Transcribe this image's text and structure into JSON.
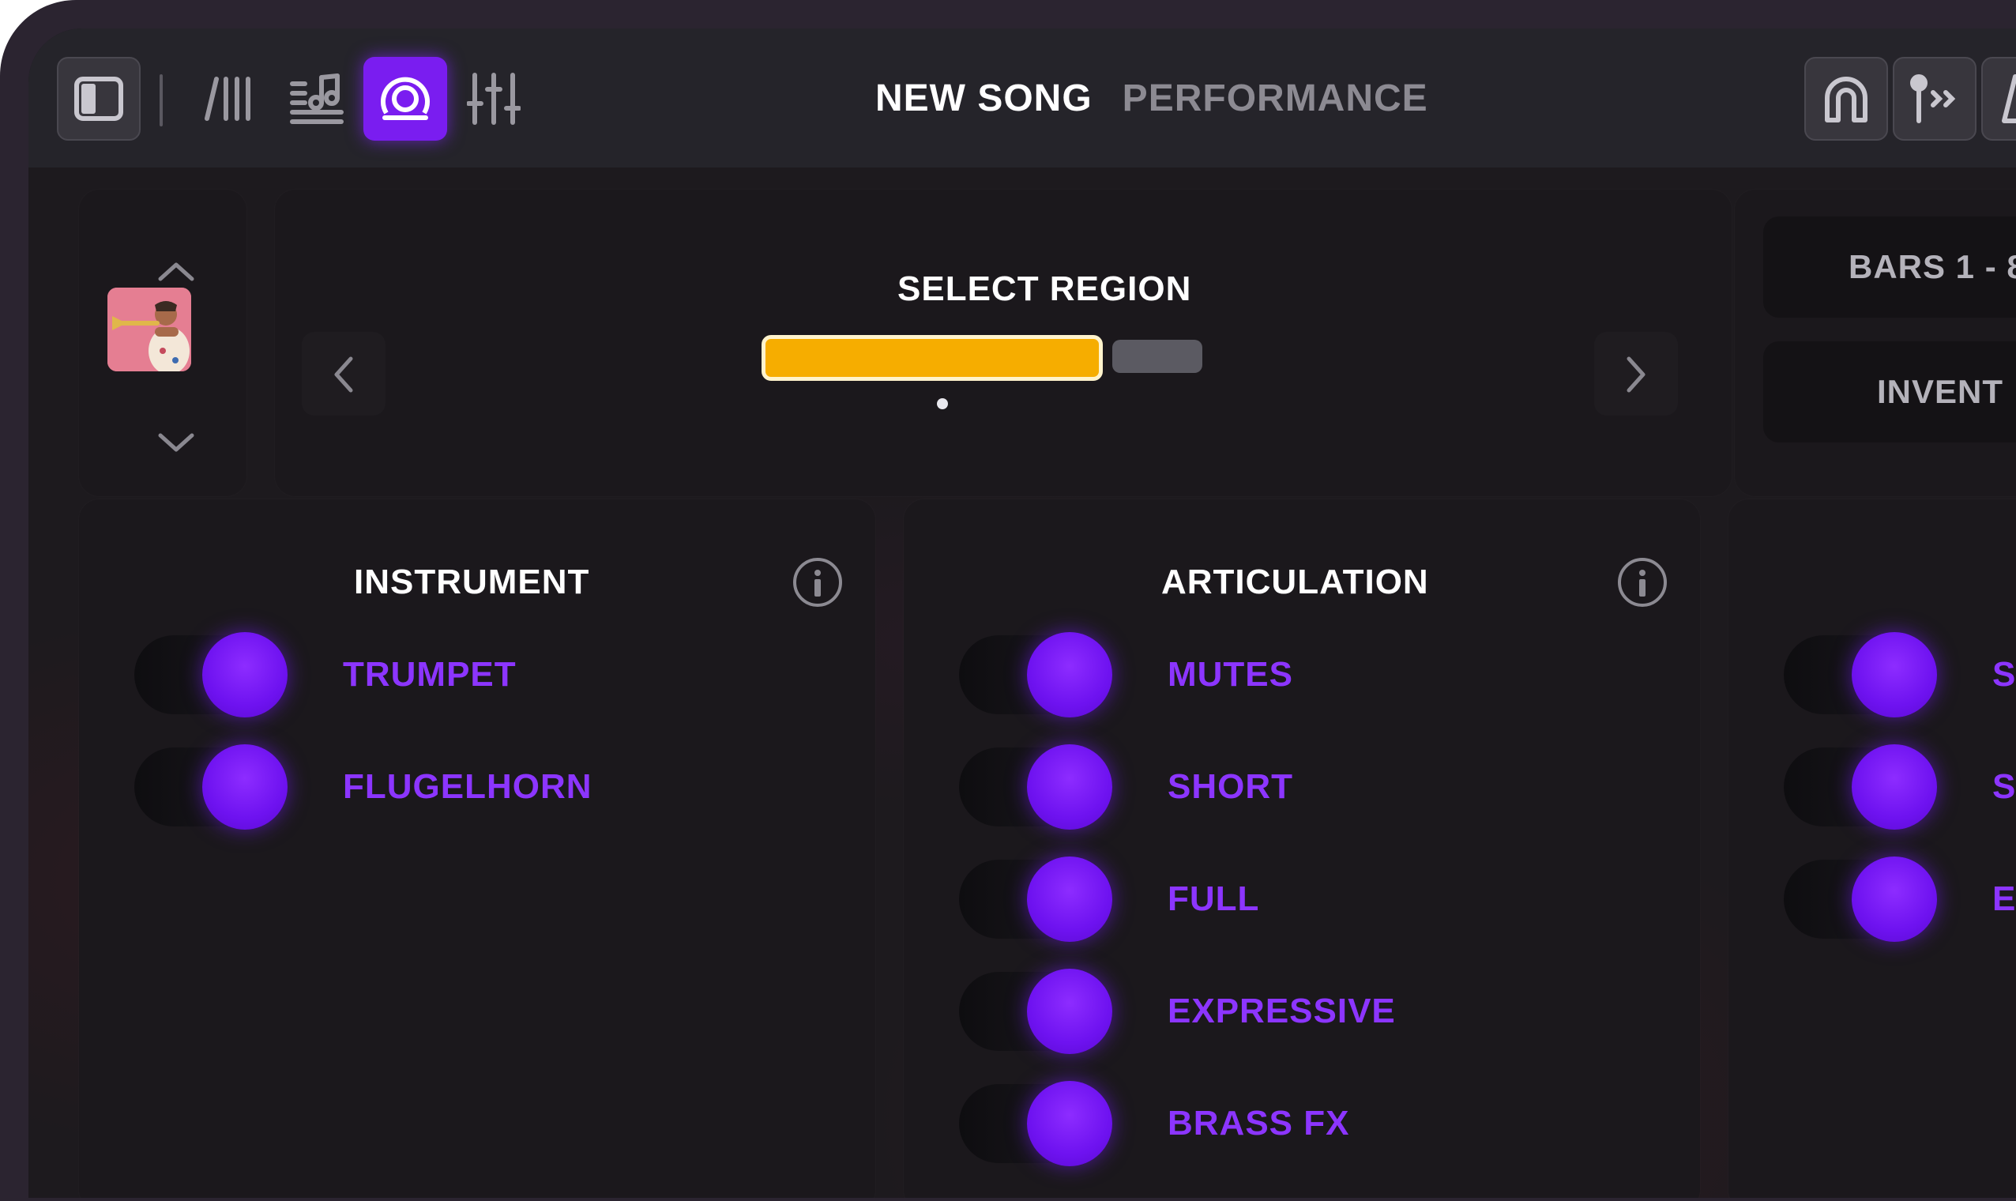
{
  "header": {
    "title": "NEW SONG",
    "subtitle": "PERFORMANCE"
  },
  "toolbar_left": [
    {
      "name": "sidebar-toggle-icon"
    },
    {
      "name": "tracks-icon"
    },
    {
      "name": "notes-icon"
    },
    {
      "name": "performance-icon",
      "active": true
    },
    {
      "name": "mixer-icon"
    }
  ],
  "toolbar_right": [
    {
      "name": "magnet-icon"
    },
    {
      "name": "routing-icon"
    },
    {
      "name": "metronome-icon"
    }
  ],
  "region": {
    "title": "SELECT REGION",
    "page_count": 2,
    "current_page": 1
  },
  "side_buttons": {
    "bars": "BARS 1 - 8",
    "invent": "INVENT"
  },
  "instrument": {
    "title": "INSTRUMENT",
    "items": [
      {
        "label": "TRUMPET",
        "on": true
      },
      {
        "label": "FLUGELHORN",
        "on": true
      }
    ]
  },
  "articulation": {
    "title": "ARTICULATION",
    "items": [
      {
        "label": "MUTES",
        "on": true
      },
      {
        "label": "SHORT",
        "on": true
      },
      {
        "label": "FULL",
        "on": true
      },
      {
        "label": "EXPRESSIVE",
        "on": true
      },
      {
        "label": "BRASS FX",
        "on": true
      }
    ]
  },
  "third_column": {
    "items": [
      {
        "label": "S",
        "on": true
      },
      {
        "label": "S",
        "on": true
      },
      {
        "label": "E",
        "on": true
      }
    ]
  },
  "colors": {
    "accent": "#7a1df0",
    "label": "#8c35ff",
    "region_selected": "#f6ad00",
    "background": "#1d1a1e"
  }
}
